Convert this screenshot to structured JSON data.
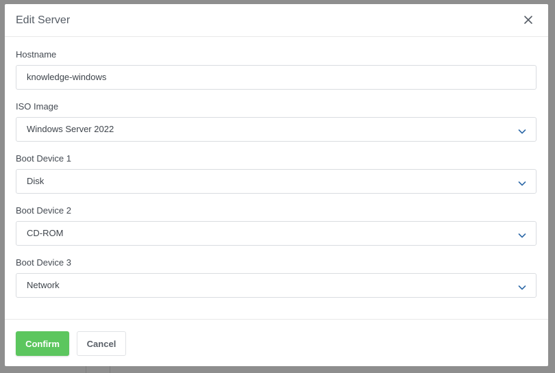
{
  "dialog": {
    "title": "Edit Server"
  },
  "fields": {
    "hostname": {
      "label": "Hostname",
      "value": "knowledge-windows"
    },
    "iso_image": {
      "label": "ISO Image",
      "value": "Windows Server 2022"
    },
    "boot_device_1": {
      "label": "Boot Device 1",
      "value": "Disk"
    },
    "boot_device_2": {
      "label": "Boot Device 2",
      "value": "CD-ROM"
    },
    "boot_device_3": {
      "label": "Boot Device 3",
      "value": "Network"
    }
  },
  "footer": {
    "confirm_label": "Confirm",
    "cancel_label": "Cancel"
  },
  "colors": {
    "confirm_green": "#5cc65e",
    "chevron_blue": "#2f6aa8",
    "backdrop": "#8e8e8e"
  },
  "icons": {
    "close": "close-icon",
    "dropdown": "chevron-down-icon"
  }
}
